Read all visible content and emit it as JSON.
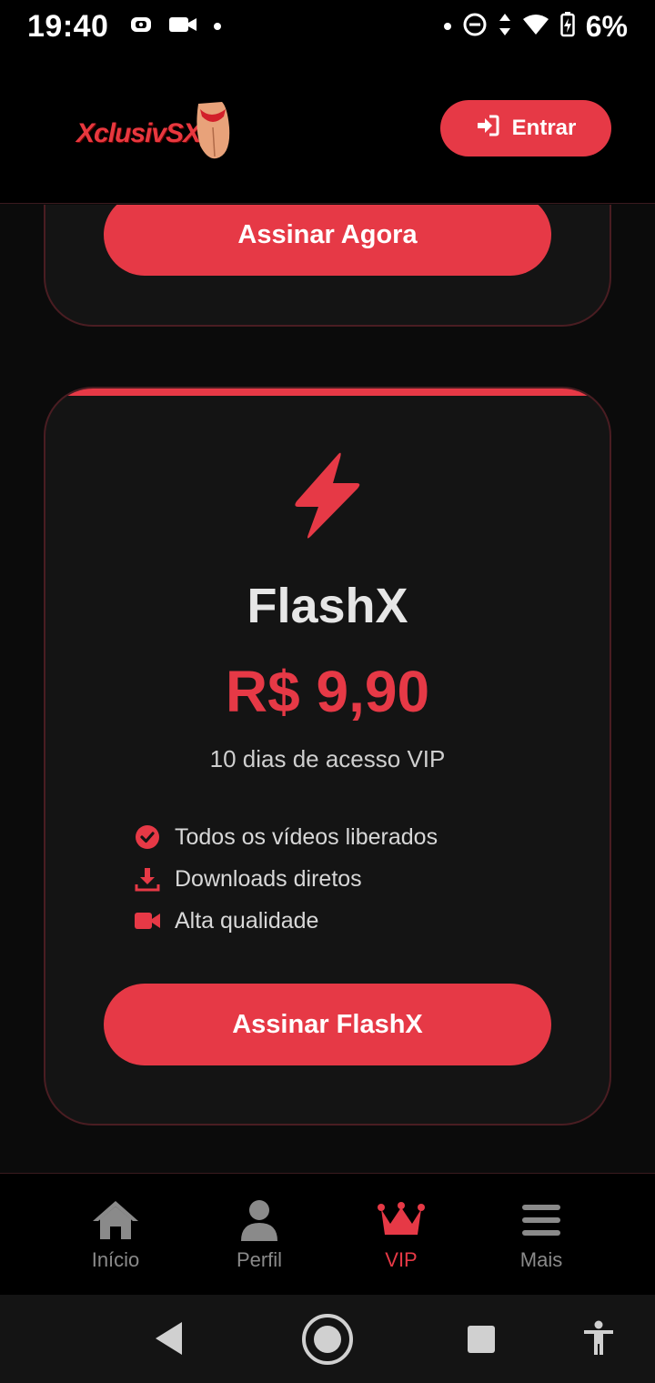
{
  "status_bar": {
    "time": "19:40",
    "battery_text": "6%",
    "icons": [
      "screen-record-icon",
      "video-camera-icon",
      "notification-dot-icon",
      "do-not-disturb-icon",
      "data-arrows-icon",
      "wifi-icon",
      "battery-charging-icon"
    ]
  },
  "header": {
    "logo_text": "XclusivSX",
    "login_label": "Entrar",
    "login_icon": "sign-in-icon"
  },
  "previous_card": {
    "button_label": "Assinar Agora"
  },
  "plan_card": {
    "icon": "lightning-bolt-icon",
    "title": "FlashX",
    "price": "R$ 9,90",
    "subtitle": "10 dias de acesso VIP",
    "features": [
      {
        "icon": "check-circle-icon",
        "label": "Todos os vídeos liberados"
      },
      {
        "icon": "download-icon",
        "label": "Downloads diretos"
      },
      {
        "icon": "video-icon",
        "label": "Alta qualidade"
      }
    ],
    "button_label": "Assinar FlashX"
  },
  "bottom_nav": {
    "items": [
      {
        "label": "Início",
        "icon": "home-icon"
      },
      {
        "label": "Perfil",
        "icon": "user-icon"
      },
      {
        "label": "VIP",
        "icon": "crown-icon",
        "active": true
      },
      {
        "label": "Mais",
        "icon": "menu-icon"
      }
    ]
  },
  "colors": {
    "accent": "#e63946",
    "background": "#0b0b0b",
    "card": "#141414",
    "border": "#4a1d22"
  }
}
